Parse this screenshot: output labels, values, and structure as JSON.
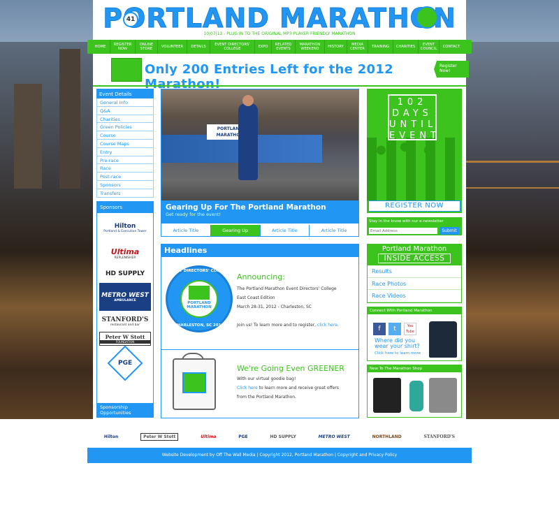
{
  "site": {
    "logo_text": "PORTLAND MARATHON",
    "edition_badge": "41",
    "tagline": "10|07|12 - PLUG IN TO THE ORIGINAL MP3 PLAYER FRIENDLY MARATHON"
  },
  "nav": {
    "items": [
      {
        "label": "HOME"
      },
      {
        "label": "REGISTER NOW"
      },
      {
        "label": "ONLINE STORE"
      },
      {
        "label": "VOLUNTEER"
      },
      {
        "label": "DETAILS"
      },
      {
        "label": "EVENT DIRECTORS' COLLEGE"
      },
      {
        "label": "EXPO"
      },
      {
        "label": "RELATED EVENTS"
      },
      {
        "label": "MARATHON WEEKEND"
      },
      {
        "label": "HISTORY"
      },
      {
        "label": "MEDIA CENTER"
      },
      {
        "label": "TRAINING"
      },
      {
        "label": "CHARITIES"
      },
      {
        "label": "EVENT COUNCIL"
      },
      {
        "label": "CONTACT"
      }
    ]
  },
  "banner": {
    "text": "Only 200 Entries Left for the 2012 Marathon!",
    "button_label": "Register Now!"
  },
  "sidebar": {
    "heading": "Event Details",
    "items": [
      {
        "label": "General Info"
      },
      {
        "label": "Q&A"
      },
      {
        "label": "Charities"
      },
      {
        "label": "Green Policies"
      },
      {
        "label": "Course"
      },
      {
        "label": "Course Maps"
      },
      {
        "label": "Entry"
      },
      {
        "label": "Pre-race"
      },
      {
        "label": "Race"
      },
      {
        "label": "Post-race"
      },
      {
        "label": "Sponsors"
      },
      {
        "label": "Transfers"
      }
    ]
  },
  "sponsors": {
    "heading": "Sponsors",
    "logos": [
      {
        "name": "Hilton",
        "sub": "Portland & Executive Tower"
      },
      {
        "name": "Ultima",
        "sub": "REPLENISHER"
      },
      {
        "name": "HD SUPPLY",
        "sub": ""
      },
      {
        "name": "METRO WEST",
        "sub": "AMBULANCE"
      },
      {
        "name": "STANFORD'S",
        "sub": "restaurant and bar"
      },
      {
        "name": "Peter W Stott",
        "sub": "FOUNDATION"
      },
      {
        "name": "PGE",
        "sub": ""
      }
    ],
    "footer": "Sponsorship Opportunities"
  },
  "slideshow": {
    "image_sign_text": "PORTLAND MARATHON",
    "caption_title": "Gearing Up For The Portland Marathon",
    "caption_sub": "Get ready for the event!",
    "tabs": [
      {
        "label": "Article Title",
        "active": false
      },
      {
        "label": "Gearing Up",
        "active": true
      },
      {
        "label": "Article Title",
        "active": false
      },
      {
        "label": "Article Title",
        "active": false
      }
    ]
  },
  "headlines": {
    "heading": "Headlines",
    "stories": [
      {
        "title": "Announcing:",
        "seal_top": "EVENT DIRECTORS' COLLEGE",
        "seal_bottom": "CHARLESTON, SC 2012",
        "seal_center": "PORTLAND MARATHON",
        "lines": [
          "The Portland Marathon Event Directors' College",
          "East Coast Edition",
          "March 28-31, 2012 - Charleston, SC"
        ],
        "cta_prefix": "Join us! To learn more and to register, ",
        "cta_link": "click here",
        "cta_suffix": "."
      },
      {
        "title": "We're Going Even GREENER",
        "line1": "With our virtual goodie bag!",
        "link": "Click here",
        "line2_rest": " to learn more and receive great offers",
        "line3": "from the Portland Marathon."
      }
    ]
  },
  "countdown": {
    "number": "102",
    "line1": "DAYS",
    "line2": "UNTIL",
    "line3": "EVENT",
    "button_label": "REGISTER NOW"
  },
  "newsletter": {
    "label": "Stay in the know with our e-newsletter",
    "placeholder": "Email Address",
    "submit_label": "Submit"
  },
  "inside_access": {
    "title": "Portland Marathon",
    "subtitle": "INSIDE ACCESS",
    "links": [
      {
        "label": "Results"
      },
      {
        "label": "Race Photos"
      },
      {
        "label": "Race Videos"
      }
    ]
  },
  "connect": {
    "heading": "Connect With Portland Marathon",
    "social": [
      {
        "icon": "facebook-icon",
        "glyph": "f"
      },
      {
        "icon": "twitter-icon",
        "glyph": "t"
      },
      {
        "icon": "youtube-icon",
        "glyph": "You Tube"
      }
    ],
    "shirt_question": "Where did you wear your shirt?",
    "shirt_link": "Click here to learn more"
  },
  "shop": {
    "heading": "New To The Marathon Shop"
  },
  "bottom_sponsors": [
    {
      "name": "Hilton"
    },
    {
      "name": "Peter W Stott"
    },
    {
      "name": "Ultima"
    },
    {
      "name": "PGE"
    },
    {
      "name": "HD SUPPLY"
    },
    {
      "name": "METRO WEST"
    },
    {
      "name": "NORTHLAND"
    },
    {
      "name": "STANFORD'S"
    }
  ],
  "footer": {
    "text": "Website Development by Off The Wall Media | Copyright 2012, Portland Marathon | Copyright and Privacy Policy"
  },
  "colors": {
    "brand_blue": "#2196f3",
    "brand_green": "#3cc31e"
  }
}
